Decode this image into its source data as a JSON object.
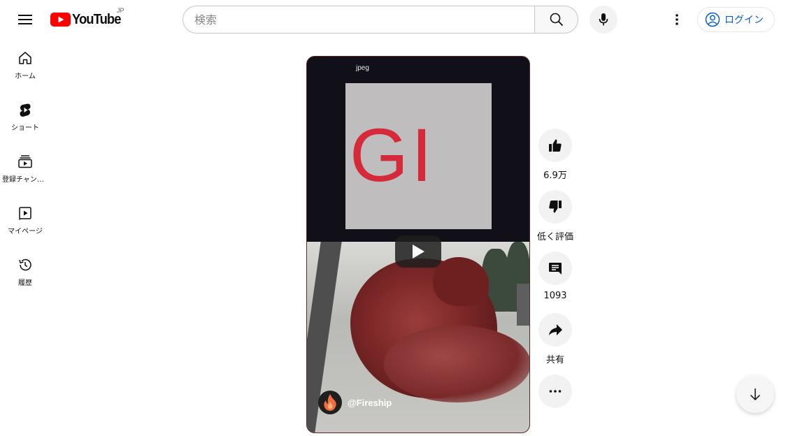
{
  "header": {
    "logo_text": "YouTube",
    "region": "JP",
    "search_placeholder": "検索",
    "search_value": "",
    "login_label": "ログイン"
  },
  "sidebar": {
    "items": [
      {
        "label": "ホーム",
        "icon": "home-icon"
      },
      {
        "label": "ショート",
        "icon": "shorts-icon"
      },
      {
        "label": "登録チャンネル",
        "icon": "subscriptions-icon"
      },
      {
        "label": "マイページ",
        "icon": "library-icon"
      },
      {
        "label": "履歴",
        "icon": "history-icon"
      }
    ]
  },
  "video": {
    "overlay_label": "jpeg",
    "overlay_big_text": "GI",
    "channel_handle": "@Fireship"
  },
  "actions": {
    "like_count": "6.9万",
    "dislike_label": "低く評価",
    "comment_count": "1093",
    "share_label": "共有"
  },
  "colors": {
    "brand_red": "#ff0000",
    "link_blue": "#065fd4",
    "overlay_text_red": "#d42a3a"
  }
}
